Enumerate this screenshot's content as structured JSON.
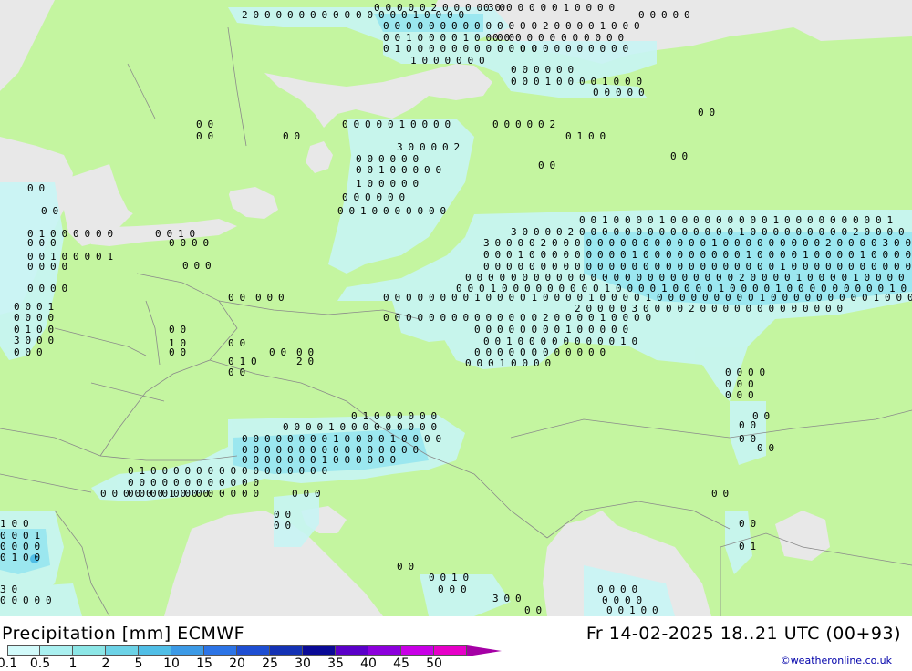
{
  "title": {
    "left": "Precipitation [mm] ECMWF",
    "right": "Fr 14-02-2025 18..21 UTC (00+93)"
  },
  "credit": "©weatheronline.co.uk",
  "legend": {
    "labels": [
      "0.1",
      "0.5",
      "1",
      "2",
      "5",
      "10",
      "15",
      "20",
      "25",
      "30",
      "35",
      "40",
      "45",
      "50"
    ],
    "colors": [
      "#d2fafa",
      "#aaf0f0",
      "#8ce6e6",
      "#6cd2e6",
      "#50bee6",
      "#3c9ae6",
      "#2c74e6",
      "#1e4ed2",
      "#1432b4",
      "#0a0a96",
      "#5a00c8",
      "#8c00dc",
      "#c800e6",
      "#e600c8",
      "#a500a5"
    ]
  },
  "colors": {
    "land": "#c4f5a0",
    "sea": "#e8e8e8",
    "precip_light": "#c8f5f5",
    "precip_medium": "#96e6f0",
    "precip_heavy": "#50bee6",
    "border": "#888888"
  },
  "precip_values": [
    {
      "v": "2",
      "c": 0
    },
    {
      "v": "1",
      "c": 1
    },
    {
      "v": "0",
      "c": 2
    },
    {
      "v": "1",
      "c": 3
    },
    {
      "v": "1",
      "c": 4
    },
    {
      "v": "0",
      "c": 5
    },
    {
      "v": "0",
      "c": 6
    },
    {
      "v": "0",
      "c": 7
    },
    {
      "v": "0",
      "c": 8
    },
    {
      "v": "1",
      "c": 9
    },
    {
      "v": "0",
      "c": 10
    },
    {
      "v": "1",
      "c": 11
    },
    {
      "v": "0",
      "c": 12
    },
    {
      "v": "0",
      "c": 13
    },
    {
      "v": "0",
      "c": 14
    },
    {
      "v": "1",
      "c": 15
    },
    {
      "v": "0",
      "c": 16
    },
    {
      "v": "0",
      "c": 17
    },
    {
      "v": "0",
      "c": 18
    },
    {
      "v": "1",
      "c": 19
    },
    {
      "v": "0",
      "c": 20
    },
    {
      "v": "1",
      "c": 21
    },
    {
      "v": "0",
      "c": 22
    },
    {
      "v": "0",
      "c": 23
    },
    {
      "v": "0",
      "c": 24
    },
    {
      "v": "2",
      "c": 25
    },
    {
      "v": "1",
      "c": 26
    },
    {
      "v": "1",
      "c": 27
    },
    {
      "v": "2",
      "c": 28
    },
    {
      "v": "1",
      "c": 29
    },
    {
      "v": "3",
      "c": 30
    },
    {
      "v": "1",
      "c": 31
    },
    {
      "v": "0",
      "c": 32
    },
    {
      "v": "1",
      "c": 33
    },
    {
      "v": "0",
      "c": 34
    }
  ]
}
